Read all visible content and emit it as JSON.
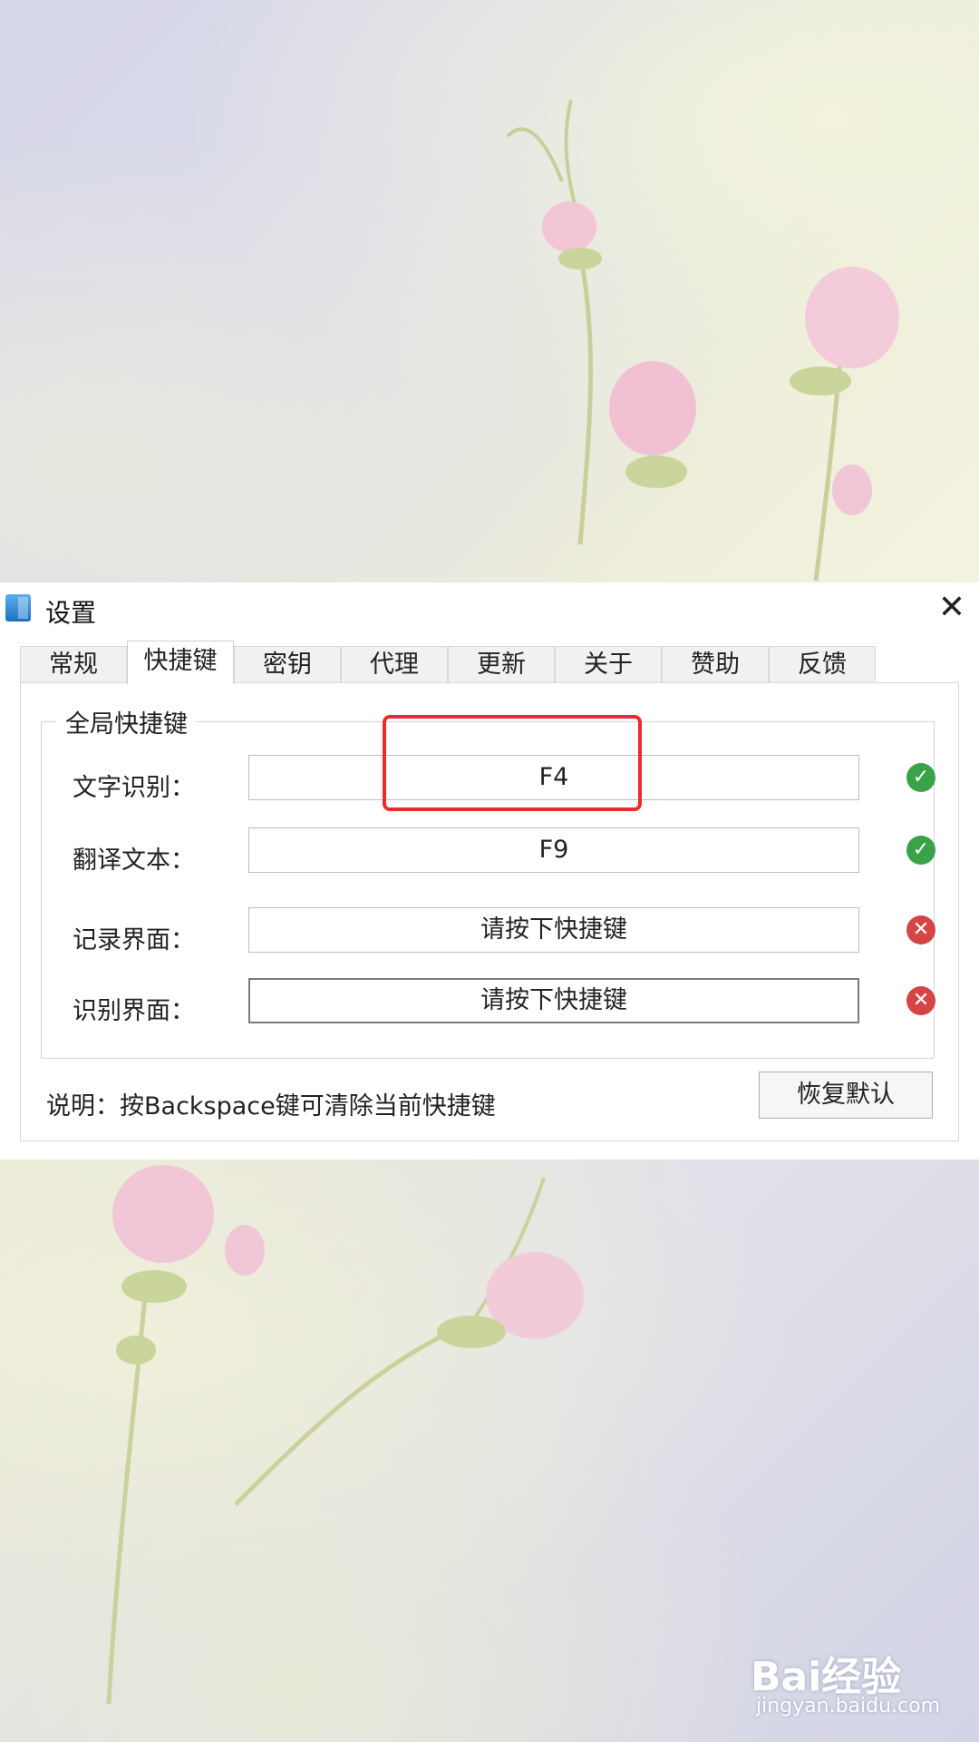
{
  "window": {
    "title": "设置",
    "close_icon": "close-icon"
  },
  "tabs": [
    {
      "label": "常规",
      "active": false
    },
    {
      "label": "快捷键",
      "active": true
    },
    {
      "label": "密钥",
      "active": false
    },
    {
      "label": "代理",
      "active": false
    },
    {
      "label": "更新",
      "active": false
    },
    {
      "label": "关于",
      "active": false
    },
    {
      "label": "赞助",
      "active": false
    },
    {
      "label": "反馈",
      "active": false
    }
  ],
  "group": {
    "title": "全局快捷键",
    "rows": [
      {
        "label": "文字识别：",
        "value": "F4",
        "status": "ok"
      },
      {
        "label": "翻译文本：",
        "value": "F9",
        "status": "ok"
      },
      {
        "label": "记录界面：",
        "value": "请按下快捷键",
        "status": "error"
      },
      {
        "label": "识别界面：",
        "value": "请按下快捷键",
        "status": "error"
      }
    ]
  },
  "footer": {
    "note": "说明：按Backspace键可清除当前快捷键",
    "reset_label": "恢复默认"
  },
  "watermark": {
    "brand": "Bai经验",
    "url": "jingyan.baidu.com"
  },
  "colors": {
    "highlight": "#ee2a2a",
    "ok": "#3aa34a",
    "error": "#d64545"
  }
}
